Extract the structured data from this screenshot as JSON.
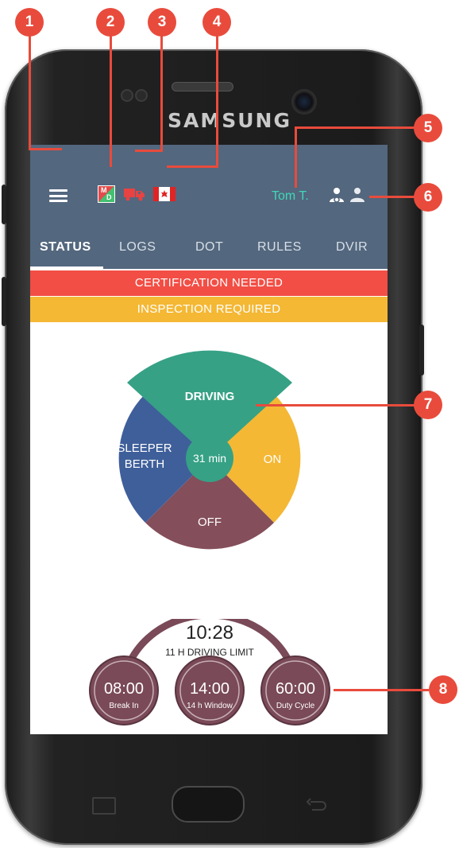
{
  "device": {
    "brand": "SAMSUNG"
  },
  "appbar": {
    "md_badge": {
      "top": "M",
      "bottom": "D"
    },
    "driver_name": "Tom T."
  },
  "tabs": [
    {
      "label": "STATUS",
      "active": true
    },
    {
      "label": "LOGS",
      "active": false
    },
    {
      "label": "DOT",
      "active": false
    },
    {
      "label": "RULES",
      "active": false
    },
    {
      "label": "DVIR",
      "active": false
    }
  ],
  "banners": {
    "certification": "CERTIFICATION NEEDED",
    "inspection": "INSPECTION REQUIRED"
  },
  "status_wheel": {
    "driving": "DRIVING",
    "sleeper_line1": "SLEEPER",
    "sleeper_line2": "BERTH",
    "on": "ON",
    "off": "OFF",
    "center": "31 min"
  },
  "limits": {
    "driving_time": "10:28",
    "driving_label": "11 H DRIVING LIMIT",
    "break_time": "08:00",
    "break_label": "Break In",
    "window_time": "14:00",
    "window_label": "14 h Window",
    "cycle_time": "60:00",
    "cycle_label": "Duty Cycle"
  },
  "markers": [
    "1",
    "2",
    "3",
    "4",
    "5",
    "6",
    "7",
    "8"
  ],
  "colors": {
    "appbar": "#53677e",
    "certification_banner": "#f24e45",
    "inspection_banner": "#f4b835",
    "driving": "#36a185",
    "sleeper": "#3f5f9a",
    "on": "#f4b835",
    "off": "#844e5b",
    "gauge": "#7a4a58",
    "marker": "#e84b3c",
    "driver_name": "#3fd8b7"
  }
}
